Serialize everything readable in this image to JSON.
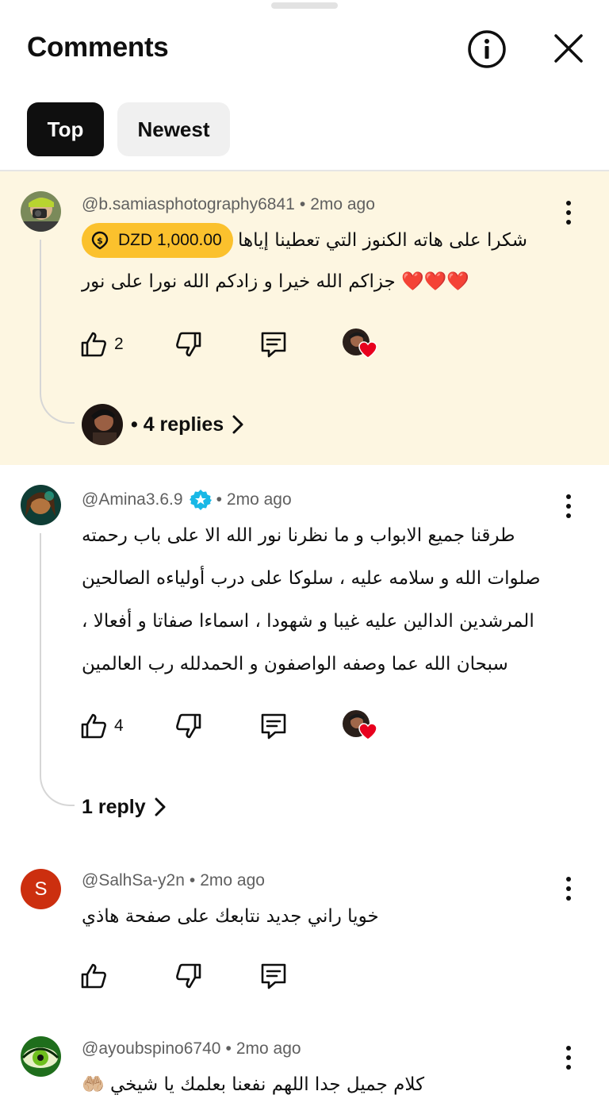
{
  "header": {
    "title": "Comments",
    "info_icon": "info-circle-icon",
    "close_icon": "close-icon"
  },
  "filters": {
    "top": "Top",
    "newest": "Newest",
    "selected": "Top"
  },
  "comments": [
    {
      "handle": "@b.samiasphotography6841",
      "age": "2mo ago",
      "tip": "DZD 1,000.00",
      "lines": [
        "شكرا على هاته الكنوز التي تعطينا إياها",
        "❤️❤️❤️ جزاكم الله خيرا و زادكم الله نورا على نور"
      ],
      "likes": "2",
      "replies": "• 4 replies",
      "creator_heart": true
    },
    {
      "handle": "@Amina3.6.9",
      "age": "2mo ago",
      "lines": [
        "طرقنا جميع الابواب و ما نظرنا نور الله الا على باب رحمته",
        "صلوات الله و سلامه عليه ، سلوكا على درب أولياءه الصالحين",
        "المرشدين الدالين عليه غيبا و شهودا ، اسماءا صفاتا و أفعالا ،",
        "سبحان الله عما وصفه الواصفون و الحمدلله رب العالمين"
      ],
      "likes": "4",
      "replies": "1 reply",
      "creator_heart": true
    },
    {
      "handle": "@SalhSa-y2n",
      "age": "2mo ago",
      "avatar_letter": "S",
      "lines": [
        "خويا راني جديد نتابعك على صفحة هاذي"
      ],
      "likes": ""
    },
    {
      "handle": "@ayoubspino6740",
      "age": "2mo ago",
      "lines": [
        "كلام جميل جدا اللهم نفعنا بعلمك يا شيخي 🤲🏼"
      ]
    }
  ],
  "colors": {
    "highlight_bg": "#fdf6e1",
    "tip_yellow": "#fbc12d",
    "avatar_red": "#cc2f0f",
    "verified_blue": "#19b8e6",
    "heart_red": "#e8001e"
  }
}
